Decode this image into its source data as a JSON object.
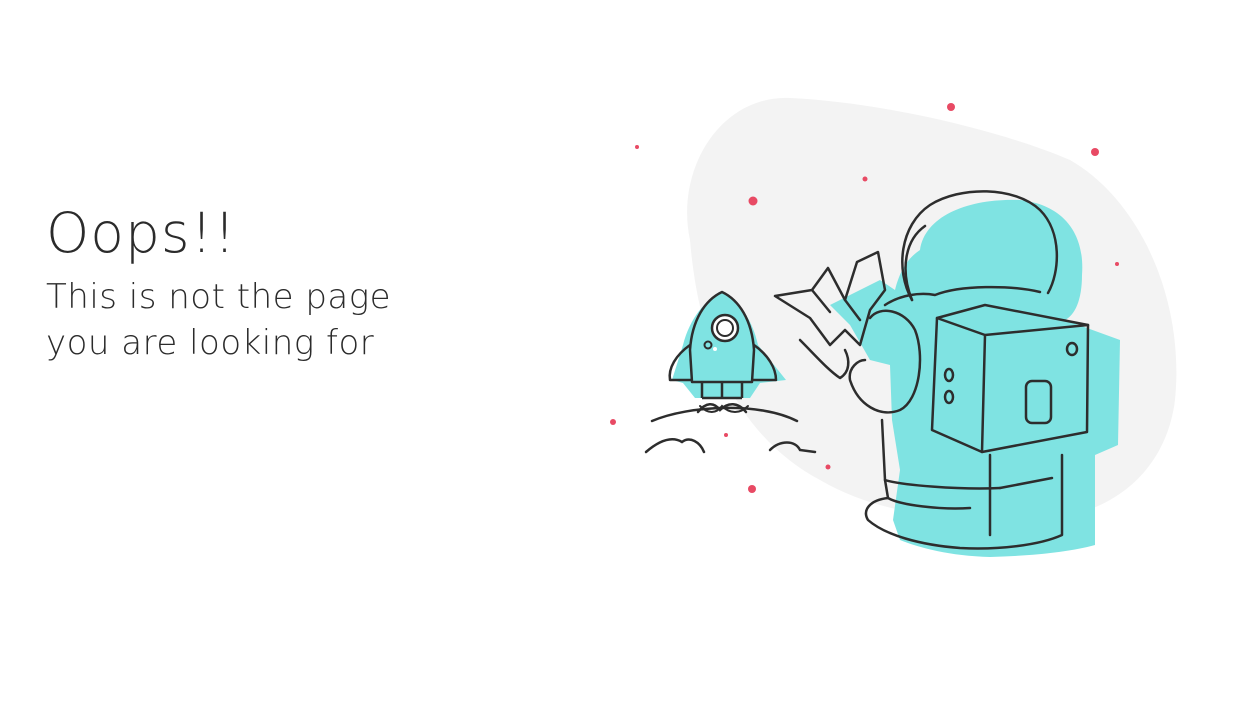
{
  "error": {
    "headline": "Oops!!",
    "message": "This is not the page you are looking for"
  },
  "illustration": {
    "icon": "astronaut-with-rocket-illustration",
    "colors": {
      "accent": "#7fe3e2",
      "outline": "#2d2d2d",
      "blob": "#f3f3f3",
      "stars": "#e84a64"
    }
  }
}
